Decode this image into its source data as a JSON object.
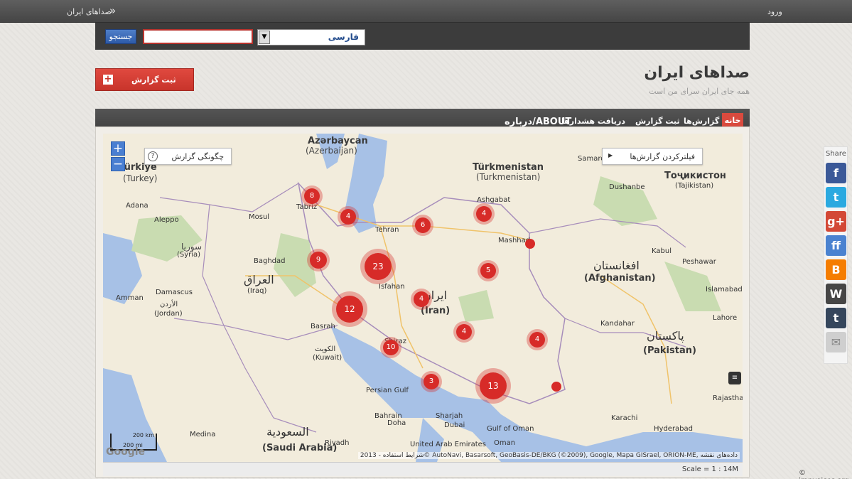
{
  "topbar": {
    "login_label": "ورود",
    "site_name": "صداهای ایران",
    "chevron": "»"
  },
  "search": {
    "button_label": "جستجو",
    "input_value": "",
    "language_value": "فارسی"
  },
  "header": {
    "title": "صداهای ایران",
    "tagline": "همه جای ایران سرای من است",
    "report_button_label": "ثبت گزارش"
  },
  "nav": {
    "items": [
      {
        "label": "خانه"
      },
      {
        "label": "گزارش‌ها"
      },
      {
        "label": "ثبت گزارش"
      },
      {
        "label": "دریافت هشدارها"
      },
      {
        "label": "درباره/ABOUT"
      }
    ]
  },
  "map": {
    "how_to_report": "چگونگی گزارش",
    "filter_label": "فیلترکردن گزارش‌ها",
    "attribution": "شرایط استفاده - 2013© AutoNavi, Basarsoft, GeoBasis-DE/BKG (©2009), Google, Mapa GISrael, ORION-ME, داده‌های نقشه",
    "google_logo": "Google",
    "scale_km": "200 km",
    "scale_mi": "200 mi",
    "scale_label": "Scale = 1 : 14M",
    "labels": [
      {
        "text": "Azərbaycan",
        "sub": "(Azerbaijan)"
      },
      {
        "text": "Türkmenistan",
        "sub": "(Turkmenistan)"
      },
      {
        "text": "Türkiye",
        "sub": "(Turkey)"
      },
      {
        "text": "Тоҷикистон",
        "sub": "(Tajikistan)"
      },
      {
        "text": "افغانستان",
        "sub": "(Afghanistan)"
      },
      {
        "text": "پاکستان",
        "sub": "(Pakistan)"
      },
      {
        "text": "العراق",
        "sub": "(Iraq)"
      },
      {
        "text": "ایران",
        "sub": "(Iran)"
      },
      {
        "text": "السعودية",
        "sub": "(Saudi Arabia)"
      },
      {
        "text": "سوريا",
        "sub": "(Syria)"
      },
      {
        "text": "الأردن",
        "sub": "(Jordan)"
      },
      {
        "text": "الكويت",
        "sub": "(Kuwait)"
      },
      {
        "text": "Tehran"
      },
      {
        "text": "Mashhad"
      },
      {
        "text": "Isfahan"
      },
      {
        "text": "Shiraz"
      },
      {
        "text": "Tabriz"
      },
      {
        "text": "Basrah"
      },
      {
        "text": "Baghdad"
      },
      {
        "text": "Damascus"
      },
      {
        "text": "Amman"
      },
      {
        "text": "Aleppo"
      },
      {
        "text": "Mosul"
      },
      {
        "text": "Adana"
      },
      {
        "text": "Kabul"
      },
      {
        "text": "Islamabad"
      },
      {
        "text": "Lahore"
      },
      {
        "text": "Peshawar"
      },
      {
        "text": "Kandahar"
      },
      {
        "text": "Karachi"
      },
      {
        "text": "Hyderabad"
      },
      {
        "text": "Dushanbe"
      },
      {
        "text": "Samarqand"
      },
      {
        "text": "Ashgabat"
      },
      {
        "text": "Doha"
      },
      {
        "text": "Dubai"
      },
      {
        "text": "Riyadh"
      },
      {
        "text": "Medina"
      },
      {
        "text": "Persian Gulf"
      },
      {
        "text": "Gulf of Oman"
      },
      {
        "text": "United Arab Emirates"
      },
      {
        "text": "Oman"
      },
      {
        "text": "Sharjah"
      },
      {
        "text": "Bahrain"
      },
      {
        "text": "Rajastha"
      }
    ],
    "clusters": [
      {
        "count": "8"
      },
      {
        "count": "4"
      },
      {
        "count": "6"
      },
      {
        "count": "4"
      },
      {
        "count": ""
      },
      {
        "count": "9"
      },
      {
        "count": "23"
      },
      {
        "count": "5"
      },
      {
        "count": "4"
      },
      {
        "count": "12"
      },
      {
        "count": "4"
      },
      {
        "count": "4"
      },
      {
        "count": "10"
      },
      {
        "count": "3"
      },
      {
        "count": "13"
      },
      {
        "count": ""
      }
    ]
  },
  "share": {
    "label": "Share",
    "icons": [
      "facebook-icon",
      "twitter-icon",
      "google-plus-icon",
      "friendfeed-icon",
      "blogger-icon",
      "wordpress-icon",
      "tumblr-icon",
      "email-icon"
    ],
    "glyphs": [
      "f",
      "t",
      "g+",
      "ff",
      "B",
      "W",
      "t",
      "✉"
    ],
    "colors": [
      "#3b5998",
      "#2aa9e0",
      "#d34836",
      "#4a82d0",
      "#f57d00",
      "#464646",
      "#35465c",
      "#cfcfcf"
    ]
  },
  "credit": "© iranvoices.org"
}
